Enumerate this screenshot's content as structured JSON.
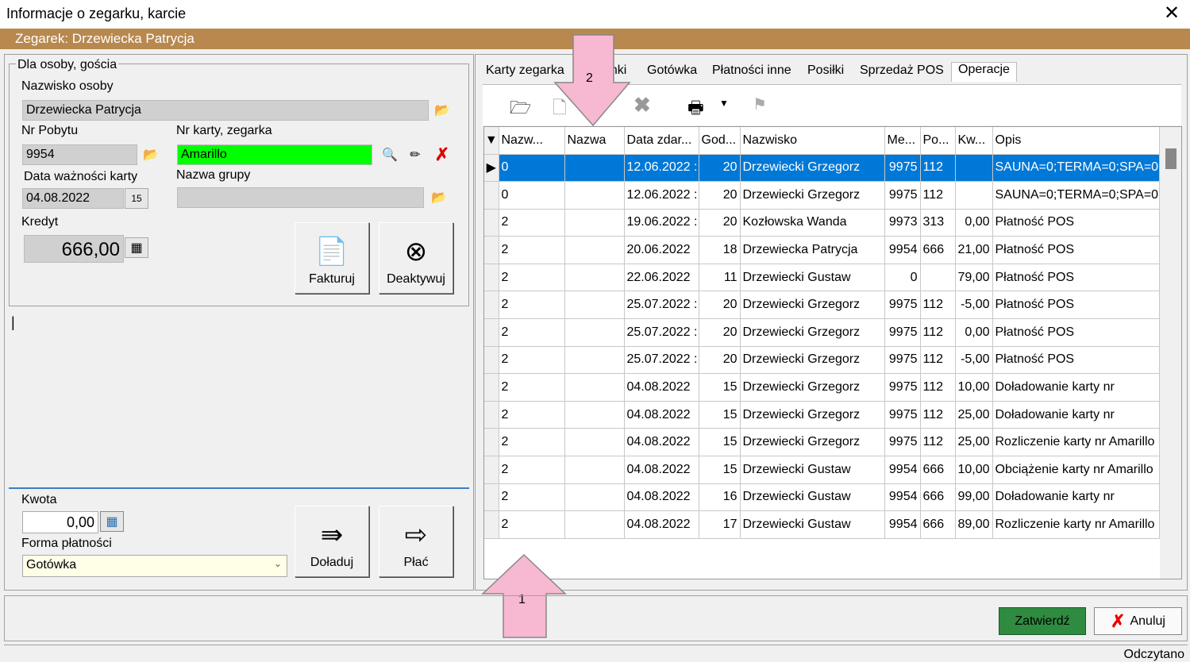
{
  "window": {
    "title": "Informacje o zegarku, karcie",
    "close": "✕"
  },
  "banner": "Zegarek: Drzewiecka Patrycja",
  "left": {
    "group_label": "Dla osoby, gościa",
    "person_label": "Nazwisko osoby",
    "person_value": "Drzewiecka Patrycja",
    "stay_label": "Nr Pobytu",
    "stay_value": "9954",
    "card_label": "Nr karty, zegarka",
    "card_value": "Amarillo",
    "validity_label": "Data ważności karty",
    "validity_value": "04.08.2022",
    "group_name_label": "Nazwa grupy",
    "group_name_value": "",
    "credit_label": "Kredyt",
    "credit_value": "666,00",
    "invoice_label": "Fakturuj",
    "deactivate_label": "Deaktywuj",
    "amount_label": "Kwota",
    "amount_value": "0,00",
    "payment_label": "Forma płatności",
    "payment_value": "Gotówka",
    "topup_label": "Doładuj",
    "pay_label": "Płać"
  },
  "tabs": [
    "Karty zegarka",
    "anki",
    "Gotówka",
    "Płatności inne",
    "Posiłki",
    "Sprzedaż POS",
    "Operacje"
  ],
  "table": {
    "headers": [
      "Nazw...",
      "Nazwa",
      "Data zdar...",
      "God...",
      "Nazwisko",
      "Me...",
      "Po...",
      "Kw...",
      "Opis"
    ],
    "rows": [
      [
        "0",
        "",
        "12.06.2022 :",
        "20",
        "Drzewiecki Grzegorz",
        "9975",
        "112",
        "",
        "SAUNA=0;TERMA=0;SPA=0"
      ],
      [
        "0",
        "",
        "12.06.2022 :",
        "20",
        "Drzewiecki Grzegorz",
        "9975",
        "112",
        "",
        "SAUNA=0;TERMA=0;SPA=0"
      ],
      [
        "2",
        "",
        "19.06.2022 :",
        "20",
        "Kozłowska Wanda",
        "9973",
        "313",
        "0,00",
        "Płatność POS"
      ],
      [
        "2",
        "",
        "20.06.2022",
        "18",
        "Drzewiecka Patrycja",
        "9954",
        "666",
        "21,00",
        "Płatność POS"
      ],
      [
        "2",
        "",
        "22.06.2022",
        "11",
        "Drzewiecki Gustaw",
        "0",
        "",
        "79,00",
        "Płatność POS"
      ],
      [
        "2",
        "",
        "25.07.2022 :",
        "20",
        "Drzewiecki Grzegorz",
        "9975",
        "112",
        "-5,00",
        "Płatność POS"
      ],
      [
        "2",
        "",
        "25.07.2022 :",
        "20",
        "Drzewiecki Grzegorz",
        "9975",
        "112",
        "0,00",
        "Płatność POS"
      ],
      [
        "2",
        "",
        "25.07.2022 :",
        "20",
        "Drzewiecki Grzegorz",
        "9975",
        "112",
        "-5,00",
        "Płatność POS"
      ],
      [
        "2",
        "",
        "04.08.2022",
        "15",
        "Drzewiecki Grzegorz",
        "9975",
        "112",
        "10,00",
        "Doładowanie karty nr"
      ],
      [
        "2",
        "",
        "04.08.2022",
        "15",
        "Drzewiecki Grzegorz",
        "9975",
        "112",
        "25,00",
        "Doładowanie karty nr"
      ],
      [
        "2",
        "",
        "04.08.2022",
        "15",
        "Drzewiecki Grzegorz",
        "9975",
        "112",
        "25,00",
        "Rozliczenie karty nr Amarillo"
      ],
      [
        "2",
        "",
        "04.08.2022",
        "15",
        "Drzewiecki Gustaw",
        "9954",
        "666",
        "10,00",
        "Obciążenie karty nr Amarillo"
      ],
      [
        "2",
        "",
        "04.08.2022",
        "16",
        "Drzewiecki Gustaw",
        "9954",
        "666",
        "99,00",
        "Doładowanie karty nr"
      ],
      [
        "2",
        "",
        "04.08.2022",
        "17",
        "Drzewiecki Gustaw",
        "9954",
        "666",
        "89,00",
        "Rozliczenie karty nr Amarillo"
      ]
    ]
  },
  "annotations": {
    "arrow1": "1",
    "arrow2": "2"
  },
  "footer": {
    "confirm": "Zatwierdź",
    "cancel": "Anuluj",
    "status": "Odczytano"
  }
}
